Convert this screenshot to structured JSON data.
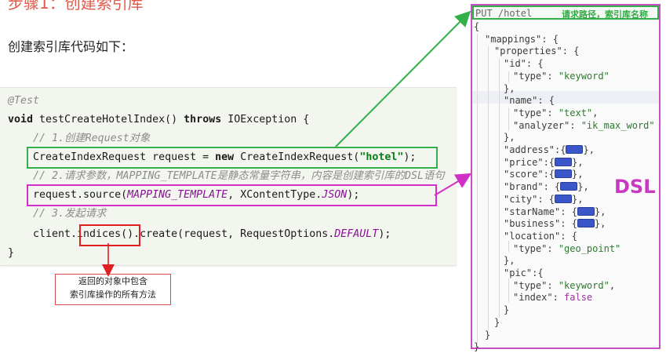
{
  "page": {
    "title_top": "步骤1：创建索引库",
    "intro": "创建索引库代码如下："
  },
  "code": {
    "lines": [
      "@Test",
      "void testCreateHotelIndex() throws IOException {",
      "// 1.创建Request对象",
      "CreateIndexRequest request = new CreateIndexRequest(\"hotel\");",
      "// 2.请求参数，MAPPING_TEMPLATE是静态常量字符串，内容是创建索引库的DSL语句",
      "request.source(MAPPING_TEMPLATE, XContentType.JSON);",
      "// 3.发起请求",
      "client.indices().create(request, RequestOptions.DEFAULT);",
      "}"
    ]
  },
  "note": {
    "line1": "返回的对象中包含",
    "line2": "索引库操作的所有方法"
  },
  "dsl": {
    "url": "PUT /hotel",
    "url_label": "请求路径，索引库名称",
    "tag": "DSL",
    "lines": [
      "{",
      "\"mappings\": {",
      "\"properties\": {",
      "\"id\": {",
      "\"type\": \"keyword\"",
      "},",
      "\"name\": {",
      "\"type\": \"text\",",
      "\"analyzer\": \"ik_max_word\"",
      "},",
      "\"address\":{",
      "\"price\":{",
      "\"score\":{",
      "\"brand\": {",
      "\"city\": {",
      "\"starName\": {",
      "\"business\": {",
      "\"location\": {",
      "\"type\": \"geo_point\"",
      "},",
      "\"pic\":{",
      "\"type\": \"keyword\",",
      "\"index\": false",
      "}",
      "}",
      "}",
      "}"
    ]
  }
}
